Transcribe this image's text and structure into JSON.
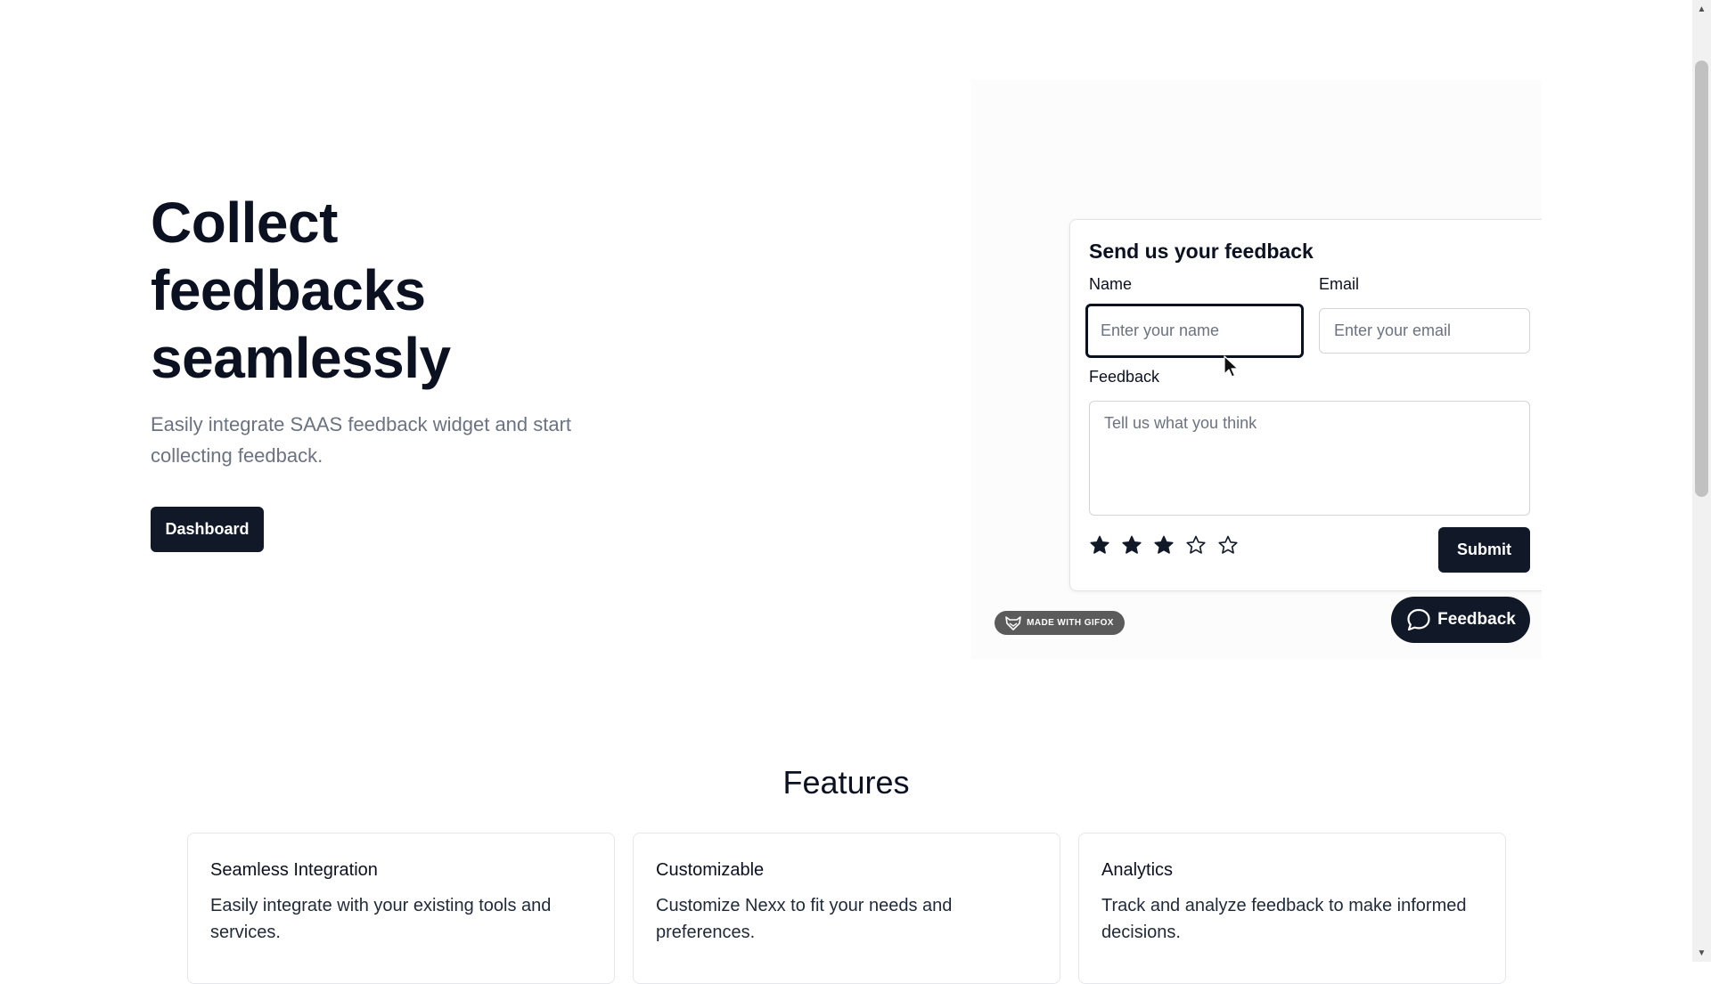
{
  "hero": {
    "title_line1": "Collect",
    "title_line2": "feedbacks",
    "title_line3": "seamlessly",
    "subtitle": "Easily integrate SAAS feedback widget and start collecting feedback.",
    "dashboard_label": "Dashboard"
  },
  "widget": {
    "title": "Send us your feedback",
    "name_label": "Name",
    "name_placeholder": "Enter your name",
    "email_label": "Email",
    "email_placeholder": "Enter your email",
    "feedback_label": "Feedback",
    "feedback_placeholder": "Tell us what you think",
    "rating": 3,
    "rating_max": 5,
    "submit_label": "Submit",
    "badge_text": "MADE WITH GIFOX",
    "launcher_label": "Feedback"
  },
  "features": {
    "title": "Features",
    "cards": [
      {
        "title": "Seamless Integration",
        "description": "Easily integrate with your existing tools and services."
      },
      {
        "title": "Customizable",
        "description": "Customize Nexx to fit your needs and preferences."
      },
      {
        "title": "Analytics",
        "description": "Track and analyze feedback to make informed decisions."
      }
    ]
  },
  "colors": {
    "primary": "#111827",
    "muted_text": "#6b7280",
    "border": "#e5e7eb"
  }
}
